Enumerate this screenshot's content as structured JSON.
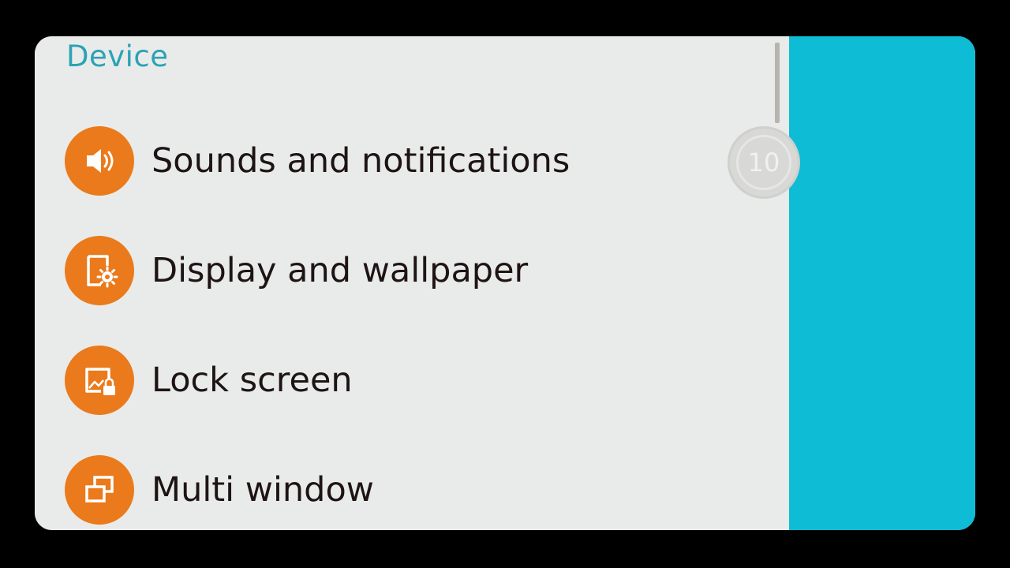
{
  "section": {
    "title": "Device"
  },
  "menu": {
    "items": [
      {
        "label": "Sounds and notifications",
        "icon": "speaker-icon"
      },
      {
        "label": "Display and wallpaper",
        "icon": "display-gear-icon"
      },
      {
        "label": "Lock screen",
        "icon": "lock-screen-icon"
      },
      {
        "label": "Multi window",
        "icon": "multi-window-icon"
      }
    ]
  },
  "badge": {
    "value": "10"
  },
  "colors": {
    "accent_orange": "#ea7a1b",
    "header_teal": "#2aa3b5",
    "side_cyan": "#0fbcd6",
    "background": "#e9ebea",
    "text": "#1e1414"
  }
}
